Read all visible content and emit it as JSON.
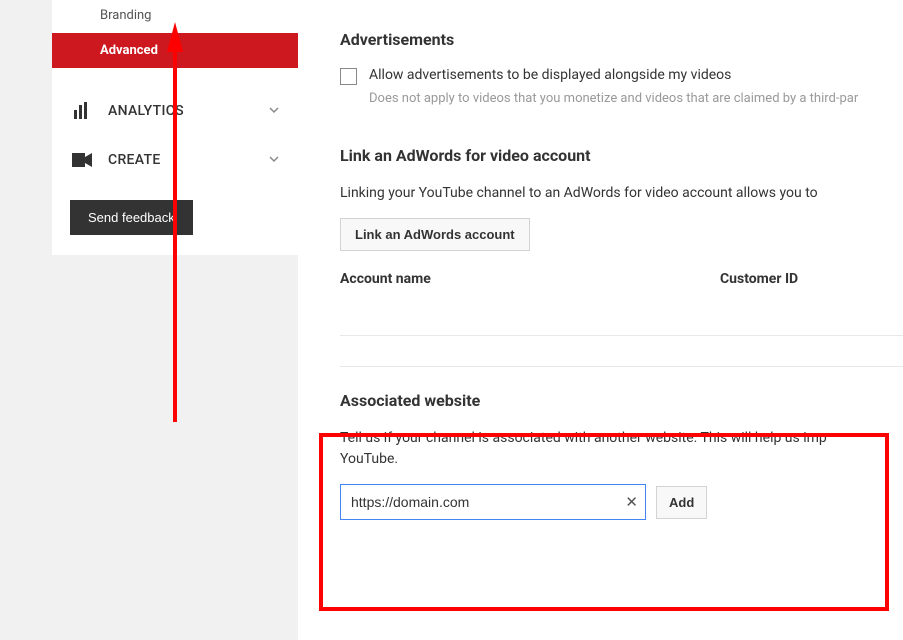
{
  "sidebar": {
    "branding_label": "Branding",
    "advanced_label": "Advanced",
    "analytics_label": "ANALYTICS",
    "create_label": "CREATE",
    "feedback_label": "Send feedback"
  },
  "ads": {
    "title": "Advertisements",
    "checkbox_label": "Allow advertisements to be displayed alongside my videos",
    "hint": "Does not apply to videos that you monetize and videos that are claimed by a third-par"
  },
  "adwords": {
    "title": "Link an AdWords for video account",
    "desc": "Linking your YouTube channel to an AdWords for video account allows you to",
    "link_button": "Link an AdWords account",
    "col_account": "Account name",
    "col_customer": "Customer ID"
  },
  "assoc": {
    "title": "Associated website",
    "desc": "Tell us if your channel is associated with another website. This will help us imp YouTube.",
    "url_value": "https://domain.com",
    "add_label": "Add"
  }
}
